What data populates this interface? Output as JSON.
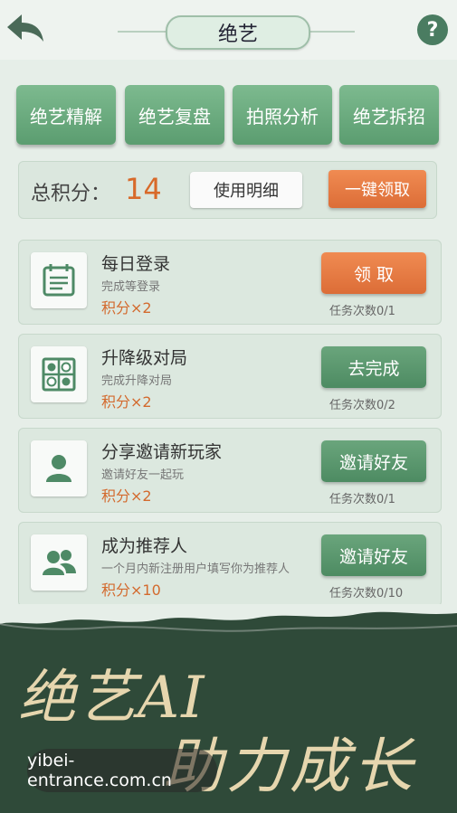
{
  "header": {
    "title": "绝艺"
  },
  "tabs": [
    {
      "label": "绝艺精解"
    },
    {
      "label": "绝艺复盘"
    },
    {
      "label": "拍照分析"
    },
    {
      "label": "绝艺拆招"
    }
  ],
  "score": {
    "label": "总积分：",
    "value": "14",
    "detail_button": "使用明细",
    "claim_all_button": "一键领取"
  },
  "tasks": [
    {
      "name": "每日登录",
      "desc": "完成等登录",
      "points": "积分×2",
      "button": "领 取",
      "count": "任务次数0/1",
      "icon": "calendar-icon"
    },
    {
      "name": "升降级对局",
      "desc": "完成升降对局",
      "points": "积分×2",
      "button": "去完成",
      "count": "任务次数0/2",
      "icon": "board-icon"
    },
    {
      "name": "分享邀请新玩家",
      "desc": "邀请好友一起玩",
      "points": "积分×2",
      "button": "邀请好友",
      "count": "任务次数0/1",
      "icon": "person-icon"
    },
    {
      "name": "成为推荐人",
      "desc": "一个月内新注册用户填写你为推荐人",
      "points": "积分×10",
      "button": "邀请好友",
      "count": "任务次数0/10",
      "icon": "people-icon"
    }
  ],
  "banner": {
    "line1": "绝艺AI",
    "line2": "助力成长",
    "watermark": "yibei-entrance.com.cn"
  },
  "colors": {
    "accent_green": "#5b9d70",
    "accent_orange": "#dc6d37",
    "banner_bg": "#2f4a39"
  }
}
